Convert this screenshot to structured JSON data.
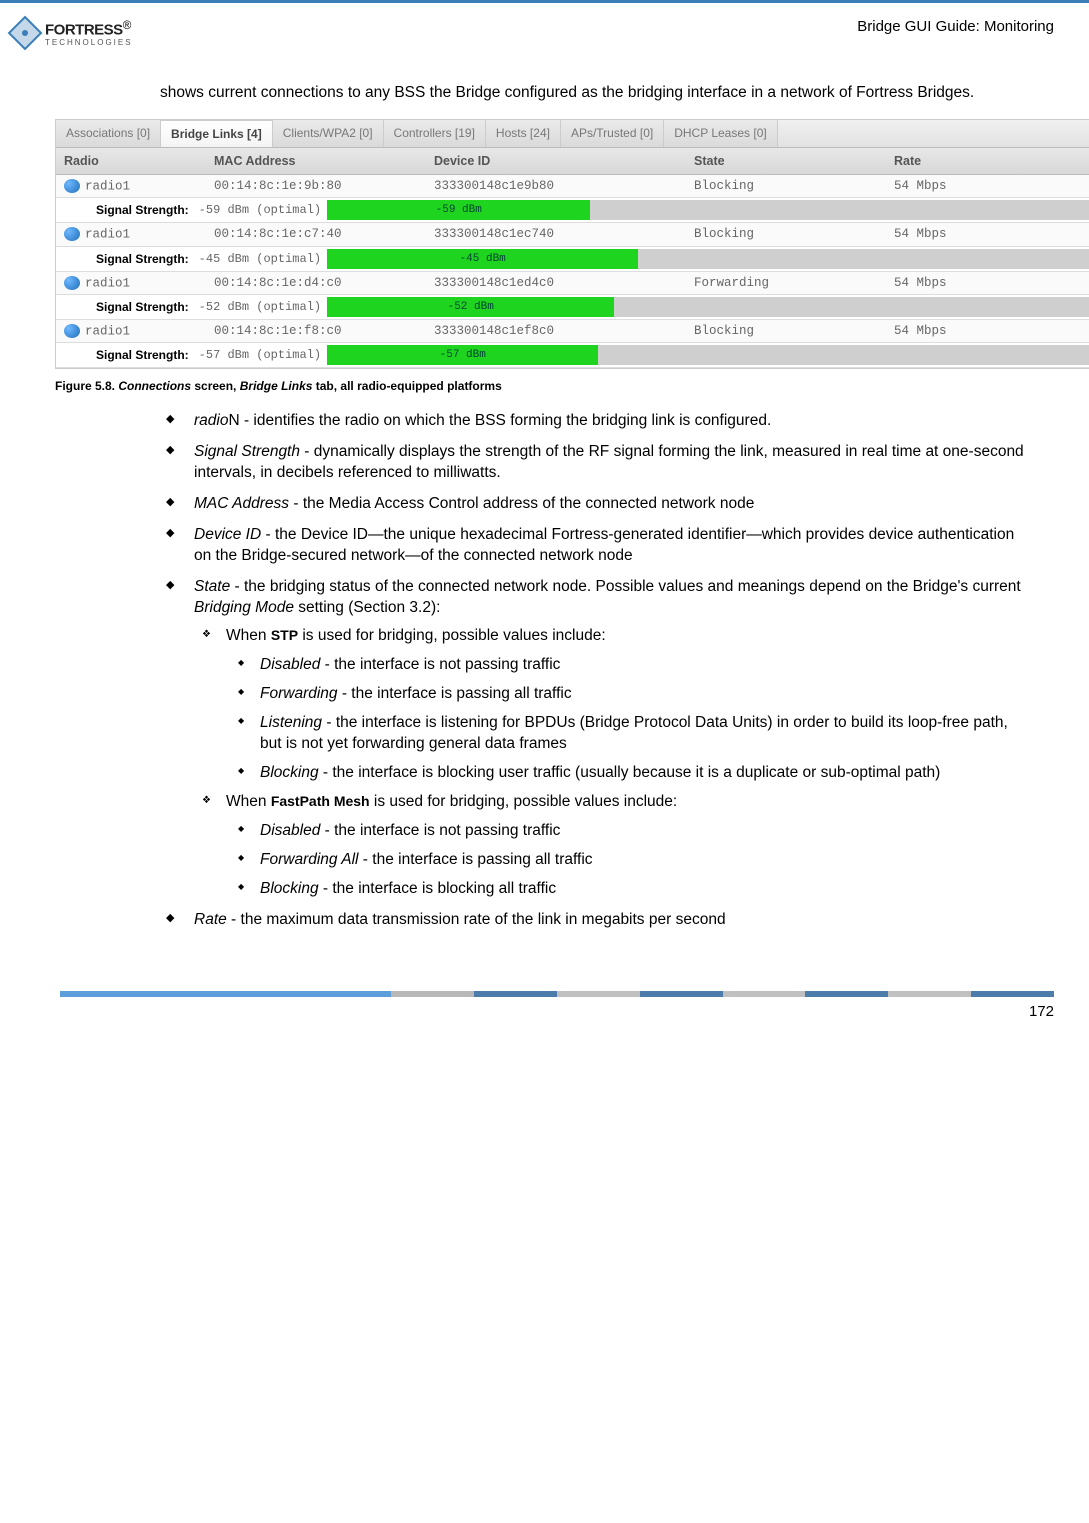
{
  "header": {
    "brand_main": "FORTRESS",
    "brand_sub": "TECHNOLOGIES",
    "brand_reg": "®",
    "page_title": "Bridge GUI Guide: Monitoring"
  },
  "intro": "shows current connections to any BSS the Bridge configured as the bridging interface in a network of Fortress Bridges.",
  "tabs": {
    "t0": "Associations [0]",
    "t1": "Bridge Links [4]",
    "t2": "Clients/WPA2 [0]",
    "t3": "Controllers [19]",
    "t4": "Hosts [24]",
    "t5": "APs/Trusted [0]",
    "t6": "DHCP Leases [0]"
  },
  "thead": {
    "c0": "Radio",
    "c1": "MAC Address",
    "c2": "Device ID",
    "c3": "State",
    "c4": "Rate"
  },
  "rows": {
    "r0": {
      "radio": "radio1",
      "mac": "00:14:8c:1e:9b:80",
      "device": "333300148c1e9b80",
      "state": "Blocking",
      "rate": "54 Mbps",
      "sigtxt": "-59 dBm (optimal)",
      "sigbar": "-59 dBm",
      "sigw": "33%"
    },
    "r1": {
      "radio": "radio1",
      "mac": "00:14:8c:1e:c7:40",
      "device": "333300148c1ec740",
      "state": "Blocking",
      "rate": "54 Mbps",
      "sigtxt": "-45 dBm (optimal)",
      "sigbar": "-45 dBm",
      "sigw": "39%"
    },
    "r2": {
      "radio": "radio1",
      "mac": "00:14:8c:1e:d4:c0",
      "device": "333300148c1ed4c0",
      "state": "Forwarding",
      "rate": "54 Mbps",
      "sigtxt": "-52 dBm (optimal)",
      "sigbar": "-52 dBm",
      "sigw": "36%"
    },
    "r3": {
      "radio": "radio1",
      "mac": "00:14:8c:1e:f8:c0",
      "device": "333300148c1ef8c0",
      "state": "Blocking",
      "rate": "54 Mbps",
      "sigtxt": "-57 dBm (optimal)",
      "sigbar": "-57 dBm",
      "sigw": "34%"
    }
  },
  "siglabel": "Signal Strength:",
  "figcap": {
    "prefix": "Figure 5.8.  ",
    "c_em": "Connections",
    "mid": " screen, ",
    "bl_em": "Bridge Links",
    "suffix": " tab, all radio-equipped platforms"
  },
  "bullets": {
    "b0a": "radio",
    "b0b": "N - identifies the radio on which the BSS forming the bridging link is configured.",
    "b1a": "Signal Strength",
    "b1b": " - dynamically displays the strength of the RF signal forming the link, measured in real time at one-second intervals, in decibels referenced to milliwatts.",
    "b2a": "MAC Address",
    "b2b": " - the Media Access Control address of the connected network node",
    "b3a": "Device ID",
    "b3b": " - the Device ID—the unique hexadecimal Fortress-generated identifier—which provides device authentication on the Bridge-secured network—of the connected network node",
    "b4a": "State",
    "b4b": " - the bridging status of the connected network node. Possible values and meanings depend on the Bridge's current ",
    "b4c": "Bridging Mode",
    "b4d": " setting (Section 3.2):",
    "s1pre": "When ",
    "s1b": "STP",
    "s1post": " is used for bridging, possible values include:",
    "s1_1a": "Disabled",
    "s1_1b": " - the interface is not passing traffic",
    "s1_2a": "Forwarding",
    "s1_2b": " - the interface is passing all traffic",
    "s1_3a": "Listening",
    "s1_3b": " - the interface is listening for BPDUs (Bridge Protocol Data Units) in order to build its loop-free path, but is not yet forwarding general data frames",
    "s1_4a": "Blocking",
    "s1_4b": " - the interface is blocking user traffic (usually because it is a duplicate or sub-optimal path)",
    "s2pre": "When ",
    "s2b": "FastPath Mesh",
    "s2post": " is used for bridging, possible values include:",
    "s2_1a": "Disabled",
    "s2_1b": " - the interface is not passing traffic",
    "s2_2a": "Forwarding All",
    "s2_2b": " - the interface is passing all traffic",
    "s2_3a": "Blocking",
    "s2_3b": " - the interface is blocking all traffic",
    "b5a": "Rate",
    "b5b": " - the maximum data transmission rate of the link in megabits per second"
  },
  "page_number": "172"
}
